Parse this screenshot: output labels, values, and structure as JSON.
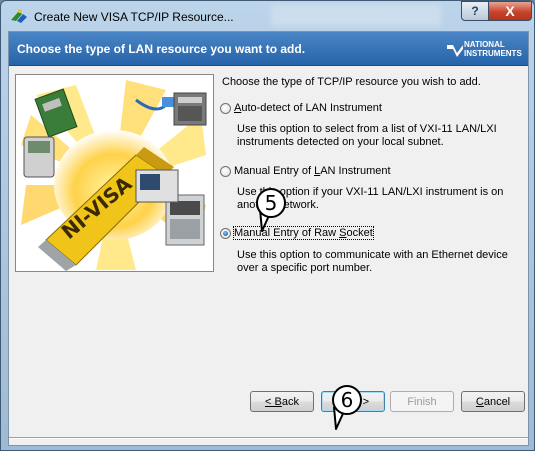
{
  "window": {
    "title": "Create New VISA TCP/IP Resource...",
    "help_label": "?",
    "close_label": "X"
  },
  "header": {
    "title": "Choose the type of LAN resource you want to add.",
    "logo_line1": "NATIONAL",
    "logo_line2": "INSTRUMENTS"
  },
  "image": {
    "brand_text": "NI-VISA"
  },
  "content": {
    "question": "Choose the type of TCP/IP resource you wish to add.",
    "options": [
      {
        "label_underline": "A",
        "label_rest": "uto-detect of LAN Instrument",
        "selected": false,
        "description": "Use this option to select from a list of VXI-11 LAN/LXI instruments detected on your local subnet."
      },
      {
        "label_pre": "Manual Entry of ",
        "label_underline": "L",
        "label_rest": "AN Instrument",
        "selected": false,
        "description": "Use this option if your VXI-11 LAN/LXI instrument is on another network."
      },
      {
        "label_pre": "Manual Entry of Raw ",
        "label_underline": "S",
        "label_rest": "ocket",
        "selected": true,
        "description": "Use this option to communicate with an Ethernet device over a specific port number."
      }
    ]
  },
  "buttons": {
    "back": {
      "underline": "< B",
      "rest": "ack"
    },
    "next": {
      "underline": "N",
      "rest": "ext >"
    },
    "finish": {
      "label": "Finish",
      "enabled": false
    },
    "cancel": {
      "underline": "C",
      "rest": "ancel"
    }
  },
  "callouts": {
    "step5": "5",
    "step6": "6"
  },
  "colors": {
    "header_blue": "#2f6db3",
    "selected_radio": "#0b4f9c",
    "close_red": "#c7442c"
  }
}
